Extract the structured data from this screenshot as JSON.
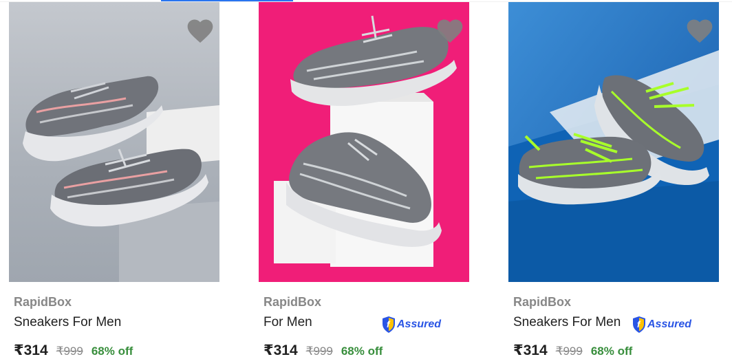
{
  "products": [
    {
      "brand": "RapidBox",
      "title": "Sneakers For Men",
      "price": "₹314",
      "mrp": "₹999",
      "discount": "68% off",
      "assured": false,
      "image": {
        "background": "#b9bdc4",
        "accent": "#e9a0a2",
        "description": "pair of grey knit sneakers"
      }
    },
    {
      "brand": "RapidBox",
      "title": "For Men",
      "price": "₹314",
      "mrp": "₹999",
      "discount": "68% off",
      "assured": true,
      "assured_label": "Assured",
      "image": {
        "background": "#f01e78",
        "accent": "#cfd3d6",
        "description": "pair of grey knit sneakers on white block"
      }
    },
    {
      "brand": "RapidBox",
      "title": "Sneakers For Men",
      "price": "₹314",
      "mrp": "₹999",
      "discount": "68% off",
      "assured": true,
      "assured_label": "Assured",
      "image": {
        "background": "#1c6fbf",
        "accent": "#a8ff2a",
        "description": "pair of grey sneakers with neon laces"
      }
    }
  ],
  "colors": {
    "brand_text": "#878787",
    "title_text": "#212121",
    "discount": "#388e3c",
    "assured": "#2a55e5",
    "heart": "#808080"
  },
  "icons": {
    "wishlist": "heart-icon",
    "assured": "flipkart-assured-badge-icon"
  }
}
